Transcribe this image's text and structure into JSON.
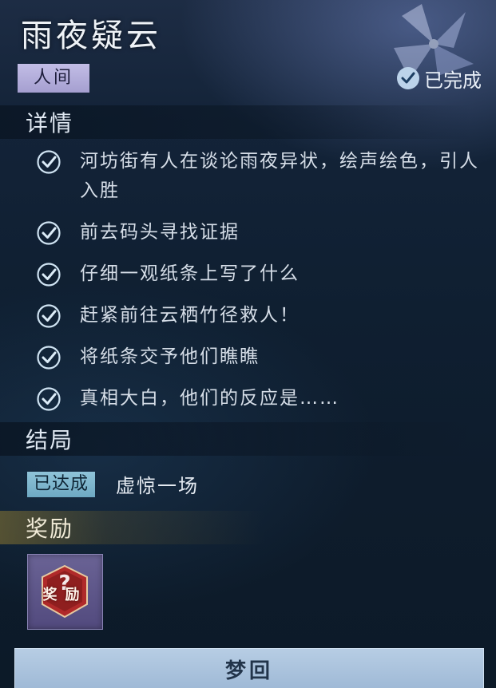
{
  "quest": {
    "title": "雨夜疑云",
    "region_tag": "人间",
    "status_label": "已完成"
  },
  "details": {
    "header": "详情",
    "tasks": [
      {
        "text": "河坊街有人在谈论雨夜异状，绘声绘色，引人入胜",
        "done": true
      },
      {
        "text": "前去码头寻找证据",
        "done": true
      },
      {
        "text": "仔细一观纸条上写了什么",
        "done": true
      },
      {
        "text": "赶紧前往云栖竹径救人！",
        "done": true
      },
      {
        "text": "将纸条交予他们瞧瞧",
        "done": true
      },
      {
        "text": "真相大白，他们的反应是……",
        "done": true
      }
    ]
  },
  "ending": {
    "header": "结局",
    "badge": "已达成",
    "name": "虚惊一场"
  },
  "reward": {
    "header": "奖励",
    "item_label": "奖励",
    "item_icon": "mystery-reward-icon"
  },
  "action": {
    "button_label": "梦回"
  },
  "colors": {
    "region_tag": "#b6b1e0",
    "achieved_badge": "#7fb6cd",
    "reward_card": "#5e5789",
    "button": "#a9c2dc"
  }
}
